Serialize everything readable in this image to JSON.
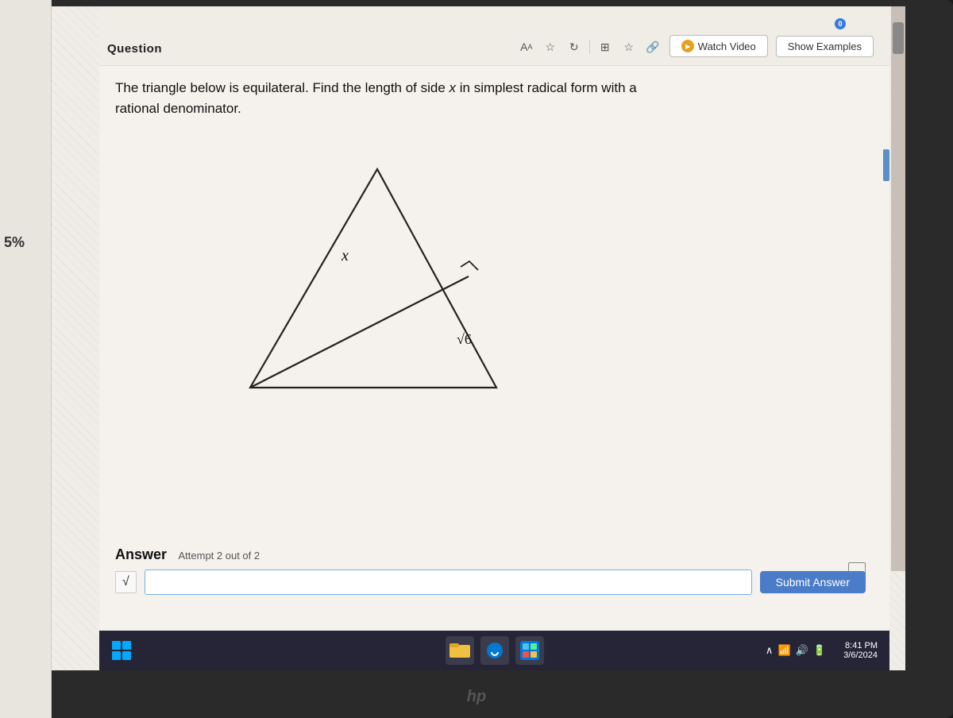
{
  "toolbar": {
    "question_label": "Question",
    "watch_video_label": "Watch Video",
    "show_examples_label": "Show Examples"
  },
  "question": {
    "text_line1": "The triangle below is equilateral. Find the length of side ",
    "variable": "x",
    "text_line2": " in simplest radical form with a",
    "text_line3": "rational denominator."
  },
  "diagram": {
    "label_x": "x",
    "label_sqrt6": "√6"
  },
  "answer": {
    "label": "Answer",
    "attempt_text": "Attempt 2 out of 2",
    "input_placeholder": "",
    "radical_symbol": "√",
    "submit_label": "Submit Answer"
  },
  "taskbar": {
    "time": "8:41 PM",
    "date": "3/6/2024"
  },
  "sidebar_badge": "5%"
}
